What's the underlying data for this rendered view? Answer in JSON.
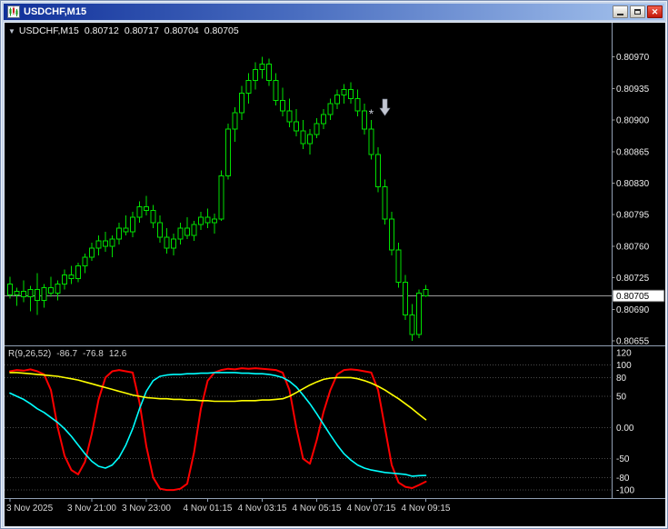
{
  "window": {
    "title": "USDCHF,M15",
    "controls": [
      {
        "name": "minimize"
      },
      {
        "name": "restore"
      },
      {
        "name": "close",
        "glyph": "✕"
      }
    ]
  },
  "chart": {
    "header": {
      "marker": "▼",
      "symbol_period": "USDCHF,M15",
      "open": "0.80712",
      "high": "0.80717",
      "low": "0.80704",
      "close": "0.80705"
    }
  },
  "colors": {
    "background": "#000000",
    "candle": "#00E000",
    "axis_text": "#EDEDED",
    "price_line": "#9B9B9B",
    "grid": "#4A4A4A",
    "separator": "#91A0B4",
    "badge_bg": "#FFFFFF",
    "badge_text": "#000000",
    "arrow": "#C3C7D2",
    "titlebar_left": "#10309A",
    "titlebar_right": "#A6C4EE",
    "close_button": "#D8301C",
    "indicator_red": "#FF0000",
    "indicator_cyan": "#00FFFF",
    "indicator_yellow": "#FFFF00"
  },
  "chart_data": {
    "type": "candlestick",
    "symbol": "USDCHF",
    "timeframe": "M15",
    "price_axis": {
      "top": 0.81008,
      "bottom": 0.8065,
      "labels": [
        "0.80970",
        "0.80935",
        "0.80900",
        "0.80865",
        "0.80830",
        "0.80795",
        "0.80760",
        "0.80725",
        "0.80690",
        "0.80655"
      ],
      "current": 0.80705,
      "current_label": "0.80705"
    },
    "candles": [
      [
        0.80718,
        0.80726,
        0.80702,
        0.80706
      ],
      [
        0.80706,
        0.80714,
        0.80694,
        0.8071
      ],
      [
        0.8071,
        0.80722,
        0.80698,
        0.80704
      ],
      [
        0.80704,
        0.80716,
        0.80688,
        0.80712
      ],
      [
        0.80712,
        0.8073,
        0.80684,
        0.807
      ],
      [
        0.807,
        0.80718,
        0.80692,
        0.80714
      ],
      [
        0.80714,
        0.80726,
        0.80704,
        0.80708
      ],
      [
        0.80708,
        0.80722,
        0.807,
        0.80718
      ],
      [
        0.80718,
        0.80734,
        0.80712,
        0.80728
      ],
      [
        0.80728,
        0.80738,
        0.80718,
        0.80724
      ],
      [
        0.80724,
        0.80742,
        0.8072,
        0.80738
      ],
      [
        0.80738,
        0.80752,
        0.8073,
        0.80748
      ],
      [
        0.80748,
        0.80764,
        0.80744,
        0.80758
      ],
      [
        0.80758,
        0.80772,
        0.8075,
        0.80766
      ],
      [
        0.80766,
        0.80776,
        0.80754,
        0.8076
      ],
      [
        0.8076,
        0.80772,
        0.80748,
        0.80768
      ],
      [
        0.80768,
        0.80786,
        0.80762,
        0.8078
      ],
      [
        0.8078,
        0.80794,
        0.80772,
        0.80776
      ],
      [
        0.80776,
        0.80798,
        0.8077,
        0.80792
      ],
      [
        0.80792,
        0.8081,
        0.80786,
        0.80804
      ],
      [
        0.80804,
        0.80816,
        0.80794,
        0.808
      ],
      [
        0.808,
        0.80806,
        0.8078,
        0.80786
      ],
      [
        0.80786,
        0.80794,
        0.80764,
        0.8077
      ],
      [
        0.8077,
        0.8078,
        0.80752,
        0.80758
      ],
      [
        0.80758,
        0.80774,
        0.8075,
        0.80768
      ],
      [
        0.80768,
        0.80786,
        0.80762,
        0.8078
      ],
      [
        0.8078,
        0.80792,
        0.80768,
        0.80772
      ],
      [
        0.80772,
        0.80788,
        0.80766,
        0.80784
      ],
      [
        0.80784,
        0.80798,
        0.80778,
        0.80792
      ],
      [
        0.80792,
        0.80802,
        0.8078,
        0.80786
      ],
      [
        0.80786,
        0.80796,
        0.80774,
        0.8079
      ],
      [
        0.8079,
        0.80844,
        0.80788,
        0.80838
      ],
      [
        0.80838,
        0.80896,
        0.80834,
        0.8089
      ],
      [
        0.8089,
        0.80914,
        0.80876,
        0.80908
      ],
      [
        0.80908,
        0.80938,
        0.809,
        0.8093
      ],
      [
        0.8093,
        0.80952,
        0.80918,
        0.80944
      ],
      [
        0.80944,
        0.80964,
        0.80934,
        0.80956
      ],
      [
        0.80956,
        0.8097,
        0.80946,
        0.80962
      ],
      [
        0.80962,
        0.80968,
        0.80938,
        0.80944
      ],
      [
        0.80944,
        0.80952,
        0.80916,
        0.80922
      ],
      [
        0.80922,
        0.80936,
        0.80904,
        0.8091
      ],
      [
        0.8091,
        0.80924,
        0.80892,
        0.80898
      ],
      [
        0.80898,
        0.80912,
        0.80882,
        0.80888
      ],
      [
        0.80888,
        0.809,
        0.80868,
        0.80874
      ],
      [
        0.80874,
        0.8089,
        0.80862,
        0.80884
      ],
      [
        0.80884,
        0.80902,
        0.8088,
        0.80896
      ],
      [
        0.80896,
        0.80912,
        0.8089,
        0.80906
      ],
      [
        0.80906,
        0.80924,
        0.809,
        0.80918
      ],
      [
        0.80918,
        0.80934,
        0.80912,
        0.80928
      ],
      [
        0.80928,
        0.8094,
        0.80918,
        0.80934
      ],
      [
        0.80934,
        0.80942,
        0.80918,
        0.80924
      ],
      [
        0.80924,
        0.80934,
        0.80904,
        0.8091
      ],
      [
        0.8091,
        0.80918,
        0.80884,
        0.8089
      ],
      [
        0.8089,
        0.809,
        0.80856,
        0.80862
      ],
      [
        0.80862,
        0.8087,
        0.8082,
        0.80826
      ],
      [
        0.80826,
        0.80834,
        0.80784,
        0.8079
      ],
      [
        0.8079,
        0.80798,
        0.8075,
        0.80756
      ],
      [
        0.80756,
        0.80764,
        0.80714,
        0.8072
      ],
      [
        0.8072,
        0.80728,
        0.80678,
        0.80684
      ],
      [
        0.80684,
        0.80696,
        0.80655,
        0.80662
      ],
      [
        0.80662,
        0.80712,
        0.80658,
        0.80708
      ],
      [
        0.80712,
        0.80717,
        0.80704,
        0.80705
      ]
    ],
    "annotations": [
      {
        "type": "arrow-down",
        "candle_index": 55,
        "price": 0.80905
      },
      {
        "type": "asterisk",
        "candle_index": 53,
        "price": 0.80902,
        "glyph": "*"
      }
    ],
    "indicator": {
      "label": "R(9,26,52)",
      "current_values": [
        "-86.7",
        "-76.8",
        "12.6"
      ],
      "scale_labels": [
        "120",
        "100",
        "80",
        "50",
        "0.00",
        "-50",
        "-80",
        "-100"
      ],
      "levels": [
        100,
        80,
        50,
        0,
        -50,
        -80,
        -100
      ],
      "range": {
        "max": 130,
        "min": -113
      },
      "series": [
        {
          "name": "fast",
          "color": "#FF0000",
          "values": [
            90,
            92,
            91,
            93,
            90,
            85,
            60,
            0,
            -45,
            -68,
            -75,
            -55,
            -10,
            45,
            80,
            90,
            92,
            90,
            88,
            40,
            -30,
            -80,
            -98,
            -100,
            -100,
            -98,
            -90,
            -40,
            30,
            75,
            88,
            92,
            94,
            93,
            95,
            94,
            95,
            94,
            93,
            92,
            88,
            60,
            0,
            -50,
            -58,
            -20,
            25,
            60,
            85,
            92,
            93,
            92,
            90,
            88,
            60,
            0,
            -60,
            -88,
            -95,
            -97,
            -92,
            -86.7
          ]
        },
        {
          "name": "slow",
          "color": "#00FFFF",
          "values": [
            55,
            50,
            45,
            38,
            30,
            24,
            16,
            8,
            -2,
            -14,
            -28,
            -42,
            -54,
            -62,
            -65,
            -60,
            -48,
            -28,
            -2,
            30,
            58,
            75,
            82,
            84,
            85,
            85,
            86,
            86,
            87,
            87,
            88,
            88,
            88,
            88,
            87,
            87,
            86,
            86,
            85,
            83,
            80,
            74,
            65,
            52,
            38,
            22,
            5,
            -12,
            -28,
            -42,
            -52,
            -60,
            -65,
            -68,
            -70,
            -72,
            -73,
            -74,
            -75,
            -78,
            -77,
            -76.8
          ]
        },
        {
          "name": "signal",
          "color": "#FFFF00",
          "values": [
            88,
            88,
            87,
            86,
            85,
            84,
            83,
            82,
            80,
            78,
            76,
            73,
            70,
            67,
            64,
            61,
            58,
            55,
            52,
            50,
            48,
            47,
            46,
            46,
            45,
            45,
            44,
            44,
            43,
            43,
            42,
            42,
            42,
            42,
            43,
            43,
            43,
            44,
            44,
            45,
            46,
            50,
            56,
            62,
            68,
            73,
            77,
            79,
            80,
            80,
            80,
            78,
            75,
            71,
            66,
            60,
            53,
            46,
            38,
            30,
            21,
            12.6
          ]
        }
      ]
    },
    "time_axis": [
      {
        "index": 0,
        "label": "3 Nov 2025"
      },
      {
        "index": 12,
        "label": "3 Nov 21:00"
      },
      {
        "index": 20,
        "label": "3 Nov 23:00"
      },
      {
        "index": 29,
        "label": "4 Nov 01:15"
      },
      {
        "index": 37,
        "label": "4 Nov 03:15"
      },
      {
        "index": 45,
        "label": "4 Nov 05:15"
      },
      {
        "index": 53,
        "label": "4 Nov 07:15"
      },
      {
        "index": 61,
        "label": "4 Nov 09:15"
      }
    ]
  }
}
